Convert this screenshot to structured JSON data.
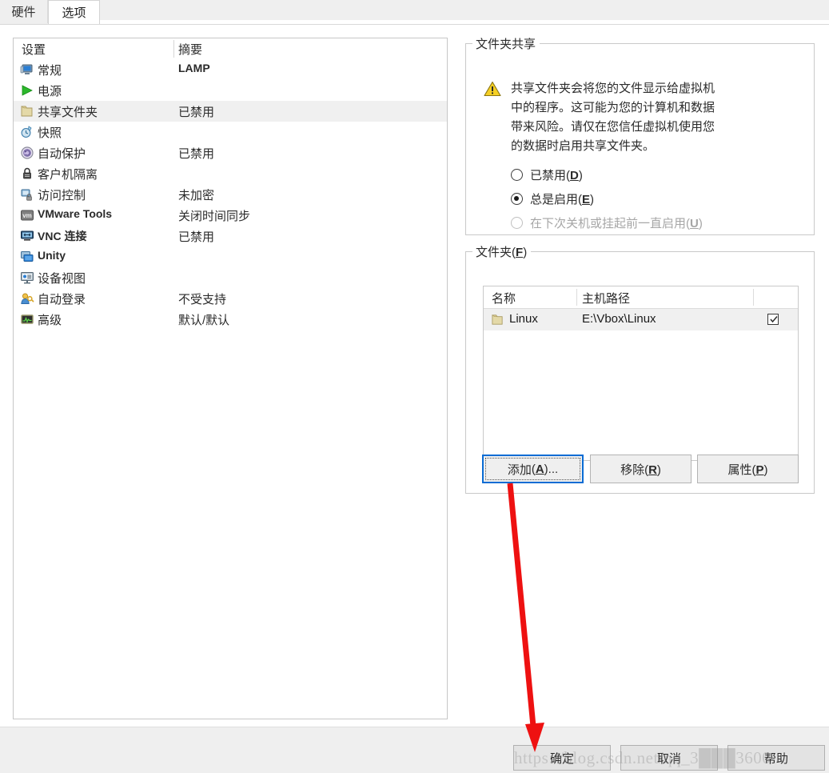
{
  "tabs": [
    {
      "label": "硬件",
      "active": false,
      "name": "tab-hardware"
    },
    {
      "label": "选项",
      "active": true,
      "name": "tab-options"
    }
  ],
  "settings_list": {
    "header": {
      "col_settings": "设置",
      "col_summary": "摘要"
    },
    "rows": [
      {
        "icon": "monitor-icon",
        "label": "常规",
        "summary": "LAMP",
        "selected": false,
        "latin_summary": true
      },
      {
        "icon": "play-green-icon",
        "label": "电源",
        "summary": "",
        "selected": false
      },
      {
        "icon": "folder-icon",
        "label": "共享文件夹",
        "summary": "已禁用",
        "selected": true
      },
      {
        "icon": "snapshot-clock-icon",
        "label": "快照",
        "summary": "",
        "selected": false
      },
      {
        "icon": "autoprotect-icon",
        "label": "自动保护",
        "summary": "已禁用",
        "selected": false
      },
      {
        "icon": "lock-icon",
        "label": "客户机隔离",
        "summary": "",
        "selected": false
      },
      {
        "icon": "access-lock-icon",
        "label": "访问控制",
        "summary": "未加密",
        "selected": false
      },
      {
        "icon": "vmware-tools-icon",
        "label": "VMware Tools",
        "summary": "关闭时间同步",
        "selected": false,
        "latin_label": true
      },
      {
        "icon": "vnc-icon",
        "label": "VNC 连接",
        "summary": "已禁用",
        "selected": false,
        "latin_label": true
      },
      {
        "icon": "unity-icon",
        "label": "Unity",
        "summary": "",
        "selected": false,
        "latin_label": true
      },
      {
        "icon": "device-view-icon",
        "label": "设备视图",
        "summary": "",
        "selected": false
      },
      {
        "icon": "autologon-key-icon",
        "label": "自动登录",
        "summary": "不受支持",
        "selected": false
      },
      {
        "icon": "advanced-chart-icon",
        "label": "高级",
        "summary": "默认/默认",
        "selected": false
      }
    ]
  },
  "folder_sharing": {
    "legend": "文件夹共享",
    "warning_icon": "warning-triangle-icon",
    "warning_lines": [
      "共享文件夹会将您的文件显示给虚拟机",
      "中的程序。这可能为您的计算机和数据",
      "带来风险。请仅在您信任虚拟机使用您",
      "的数据时启用共享文件夹。"
    ],
    "options": [
      {
        "text": "已禁用",
        "mnemonic": "D",
        "checked": false,
        "disabled": false,
        "name": "radio-disabled"
      },
      {
        "text": "总是启用",
        "mnemonic": "E",
        "checked": true,
        "disabled": false,
        "name": "radio-always-enabled"
      },
      {
        "text": "在下次关机或挂起前一直启用",
        "mnemonic": "U",
        "checked": false,
        "disabled": true,
        "name": "radio-until-shutdown"
      }
    ]
  },
  "folders": {
    "legend": "文件夹",
    "legend_mnemonic": "F",
    "columns": [
      "名称",
      "主机路径",
      ""
    ],
    "rows": [
      {
        "icon": "folder-icon",
        "name": "Linux",
        "host_path": "E:\\Vbox\\Linux",
        "enabled": true,
        "selected": true
      }
    ],
    "buttons": [
      {
        "label": "添加",
        "mnemonic": "A",
        "suffix": "...",
        "name": "add-folder-button",
        "focused": true
      },
      {
        "label": "移除",
        "mnemonic": "R",
        "suffix": "",
        "name": "remove-folder-button",
        "focused": false
      },
      {
        "label": "属性",
        "mnemonic": "P",
        "suffix": "",
        "name": "properties-folder-button",
        "focused": false
      }
    ]
  },
  "dialog_buttons": [
    {
      "label": "确定",
      "name": "ok-button"
    },
    {
      "label": "取消",
      "name": "cancel-button"
    },
    {
      "label": "帮助",
      "name": "help-button"
    }
  ],
  "watermark": {
    "text": "https://blog.csdn.net/qq_3███3600"
  },
  "annotation": {
    "type": "red-arrow",
    "color": "#ee1111"
  },
  "colors": {
    "focus_blue": "#0a6cd4",
    "selection_gray": "#f0f0f0",
    "panel_border": "#c7c7c7",
    "bottom_bar": "#efefef",
    "warning_yellow": "#f2c300",
    "arrow_red": "#ee1111"
  }
}
